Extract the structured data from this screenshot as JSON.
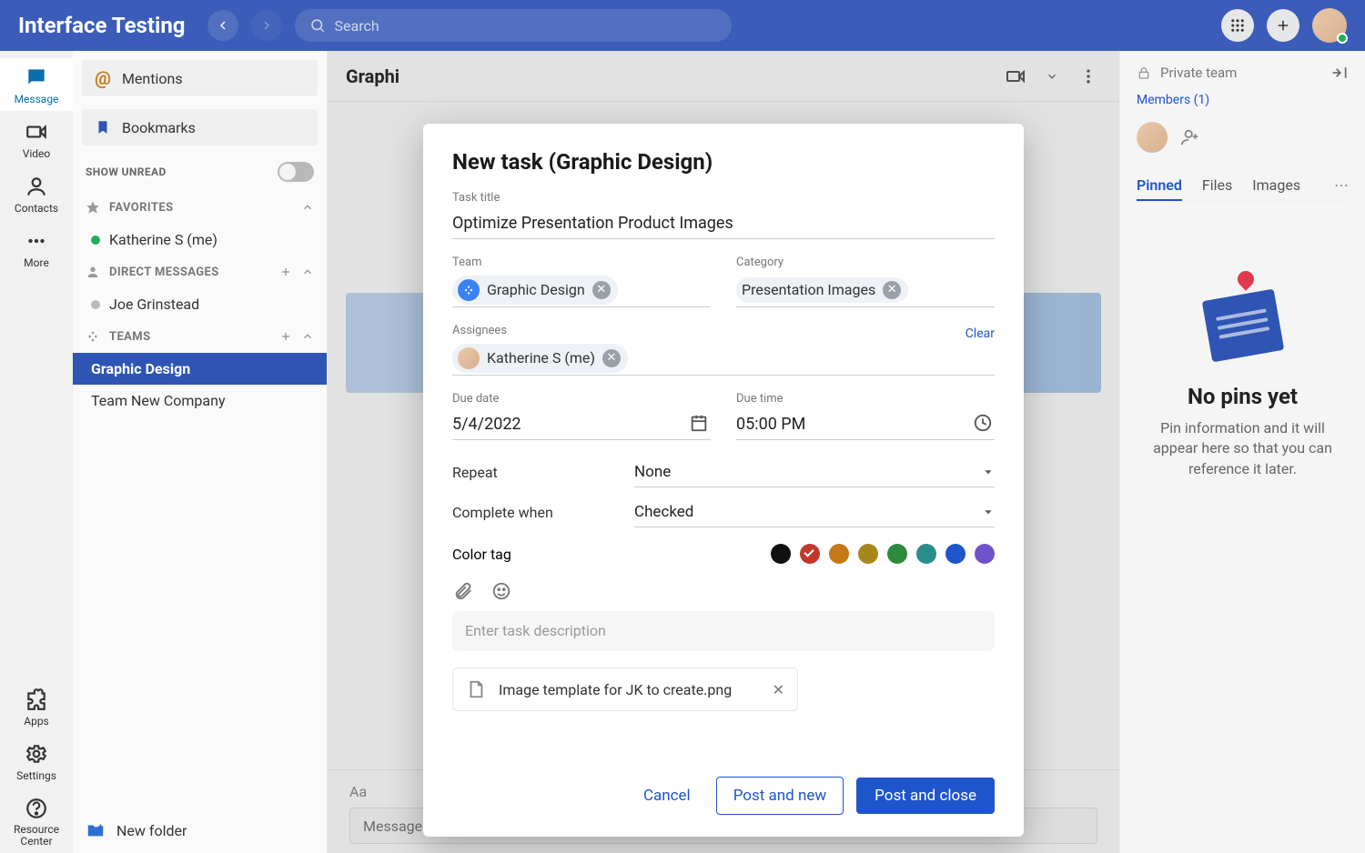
{
  "app_title": "Interface Testing",
  "search_placeholder": "Search",
  "rail": [
    {
      "key": "message",
      "label": "Message"
    },
    {
      "key": "video",
      "label": "Video"
    },
    {
      "key": "contacts",
      "label": "Contacts"
    },
    {
      "key": "more",
      "label": "More"
    }
  ],
  "rail_bottom": [
    {
      "key": "apps",
      "label": "Apps"
    },
    {
      "key": "settings",
      "label": "Settings"
    },
    {
      "key": "resource",
      "label": "Resource Center"
    }
  ],
  "sidebar": {
    "mentions": "Mentions",
    "bookmarks": "Bookmarks",
    "show_unread": "SHOW UNREAD",
    "favorites": "FAVORITES",
    "fav_items": [
      {
        "label": "Katherine S (me)",
        "online": true
      }
    ],
    "direct": "DIRECT MESSAGES",
    "dm_items": [
      {
        "label": "Joe Grinstead",
        "online": false
      }
    ],
    "teams": "TEAMS",
    "team_items": [
      {
        "label": "Graphic Design",
        "active": true
      },
      {
        "label": "Team New Company",
        "active": false
      }
    ],
    "new_folder": "New folder"
  },
  "content_header_title": "Graphi",
  "composer_placeholder": "Message",
  "right_panel": {
    "private": "Private team",
    "members": "Members (1)",
    "tabs": [
      "Pinned",
      "Files",
      "Images"
    ],
    "empty_title": "No pins yet",
    "empty_desc": "Pin information and it will appear here so that you can reference it later."
  },
  "modal": {
    "title": "New task (Graphic Design)",
    "labels": {
      "task_title": "Task title",
      "team": "Team",
      "category": "Category",
      "assignees": "Assignees",
      "clear": "Clear",
      "due_date": "Due date",
      "due_time": "Due time",
      "repeat": "Repeat",
      "complete_when": "Complete when",
      "color_tag": "Color tag",
      "description_placeholder": "Enter task description"
    },
    "values": {
      "task_title": "Optimize Presentation Product Images",
      "team_chip": "Graphic Design",
      "category_chip": "Presentation Images",
      "assignee_chip": "Katherine S (me)",
      "due_date": "5/4/2022",
      "due_time": "05:00 PM",
      "repeat": "None",
      "complete_when": "Checked"
    },
    "colors": [
      "#111111",
      "#c0392b",
      "#c47a18",
      "#a8871a",
      "#2e8b3d",
      "#2a8d8d",
      "#1f55cc",
      "#6f54c9"
    ],
    "selected_color_index": 1,
    "attachment": "Image template for JK to create.png",
    "actions": {
      "cancel": "Cancel",
      "post_new": "Post and new",
      "post_close": "Post and close"
    }
  }
}
